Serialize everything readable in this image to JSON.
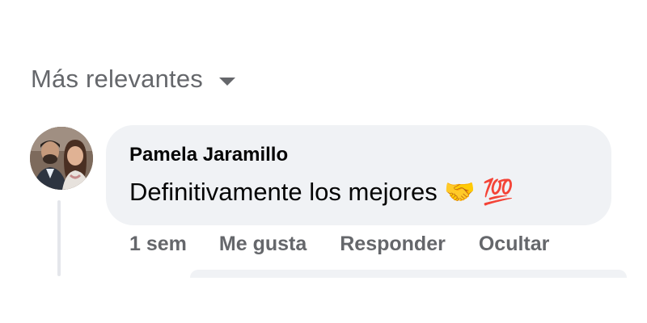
{
  "sort": {
    "label": "Más relevantes",
    "icon": "caret-down-icon"
  },
  "comment": {
    "author": "Pamela Jaramillo",
    "text": "Definitivamente los mejores 🤝 💯",
    "time": "1 sem",
    "actions": {
      "like": "Me gusta",
      "reply": "Responder",
      "hide": "Ocultar"
    },
    "avatar_icon": "profile-photo"
  },
  "colors": {
    "bubble": "#f0f2f5",
    "secondary_text": "#65676b",
    "primary_text": "#050505"
  }
}
